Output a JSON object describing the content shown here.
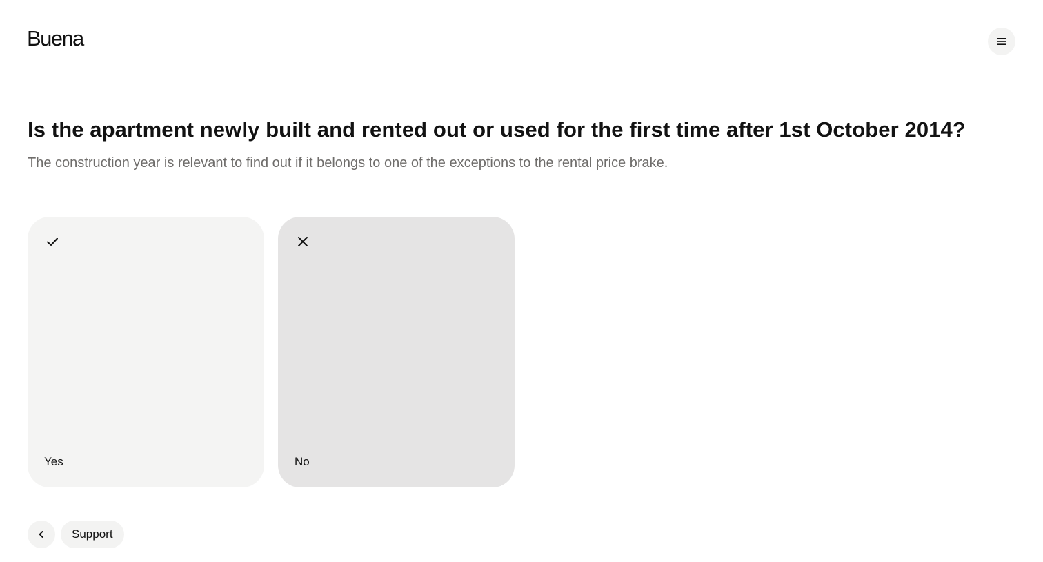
{
  "header": {
    "logo_text": "Buena",
    "menu_icon": "hamburger-menu-icon"
  },
  "question": {
    "title": "Is the apartment newly built and rented out or used for the first time after 1st October 2014?",
    "description": "The construction year is relevant to find out if it belongs to one of the exceptions to the rental price brake."
  },
  "options": [
    {
      "label": "Yes",
      "icon": "check-icon",
      "background": "#f4f4f3"
    },
    {
      "label": "No",
      "icon": "close-icon",
      "background": "#e5e4e4"
    }
  ],
  "footer": {
    "back_icon": "chevron-left-icon",
    "support_label": "Support"
  }
}
